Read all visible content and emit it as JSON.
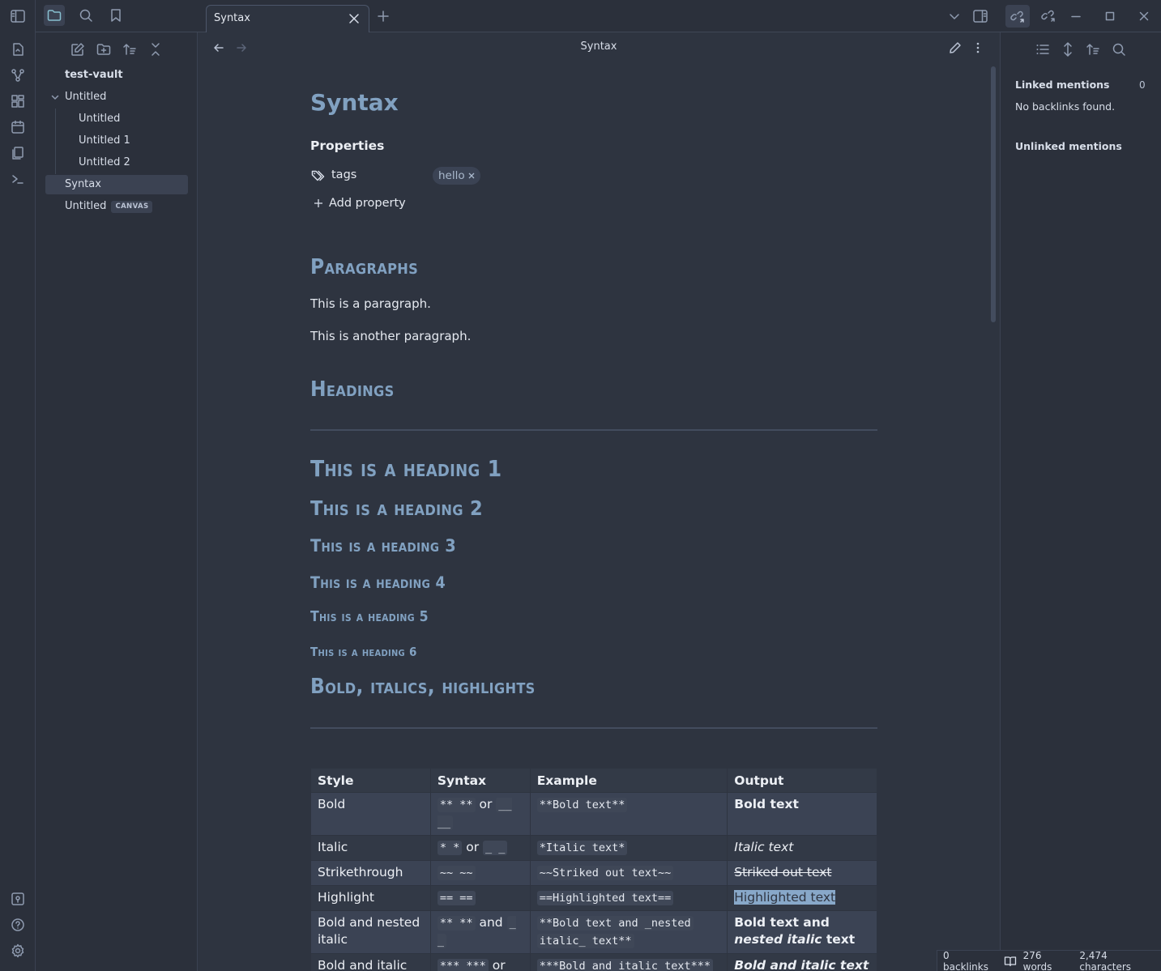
{
  "titlebar": {
    "tab_title": "Syntax"
  },
  "sidebar": {
    "vault_name": "test-vault",
    "items": [
      {
        "label": "Untitled",
        "type": "folder"
      },
      {
        "label": "Untitled"
      },
      {
        "label": "Untitled 1"
      },
      {
        "label": "Untitled 2"
      },
      {
        "label": "Syntax",
        "active": true
      },
      {
        "label": "Untitled",
        "badge": "CANVAS"
      }
    ]
  },
  "view_header": {
    "title": "Syntax"
  },
  "document": {
    "title": "Syntax",
    "properties_label": "Properties",
    "property_key": "tags",
    "tag_value": "hello",
    "add_property": "Add property",
    "sec_paragraphs": "Paragraphs",
    "para1": "This is a paragraph.",
    "para2": "This is another paragraph.",
    "sec_headings": "Headings",
    "h1": "This is a heading 1",
    "h2": "This is a heading 2",
    "h3": "This is a heading 3",
    "h4": "This is a heading 4",
    "h5": "This is a heading 5",
    "h6": "This is a heading 6",
    "sec_bold": "Bold, italics, highlights",
    "table": {
      "headers": [
        "Style",
        "Syntax",
        "Example",
        "Output"
      ],
      "rows": [
        {
          "style": "Bold",
          "syn_a": "** **",
          "syn_join": "or",
          "syn_b": "__ __",
          "example": "**Bold text**",
          "output": "Bold text"
        },
        {
          "style": "Italic",
          "syn_a": "* *",
          "syn_join": "or",
          "syn_b": "_ _",
          "example": "*Italic text*",
          "output": "Italic text"
        },
        {
          "style": "Strikethrough",
          "syn_a": "~~ ~~",
          "example": "~~Striked out text~~",
          "output": "Striked out text"
        },
        {
          "style": "Highlight",
          "syn_a": "== ==",
          "example": "==Highlighted text==",
          "output": "Highlighted text"
        },
        {
          "style": "Bold and nested italic",
          "syn_a": "** **",
          "syn_join": "and",
          "syn_b": "_ _",
          "example_a": "**Bold text and _nested",
          "example_b": "italic_ text**",
          "output_a": "Bold text and ",
          "output_b": "nested italic",
          "output_c": " text"
        },
        {
          "style": "Bold and italic",
          "syn_a": "*** ***",
          "syn_join": "or",
          "example": "***Bold and italic text***",
          "output": "Bold and italic text"
        }
      ]
    }
  },
  "right_sidebar": {
    "linked_mentions": "Linked mentions",
    "linked_count": "0",
    "no_backlinks": "No backlinks found.",
    "unlinked_mentions": "Unlinked mentions"
  },
  "statusbar": {
    "backlinks": "0 backlinks",
    "words": "276 words",
    "characters": "2,474 characters"
  },
  "colors": {
    "background": "#2e3440",
    "heading": "#81a1c1",
    "highlight": "#88a8c9"
  }
}
